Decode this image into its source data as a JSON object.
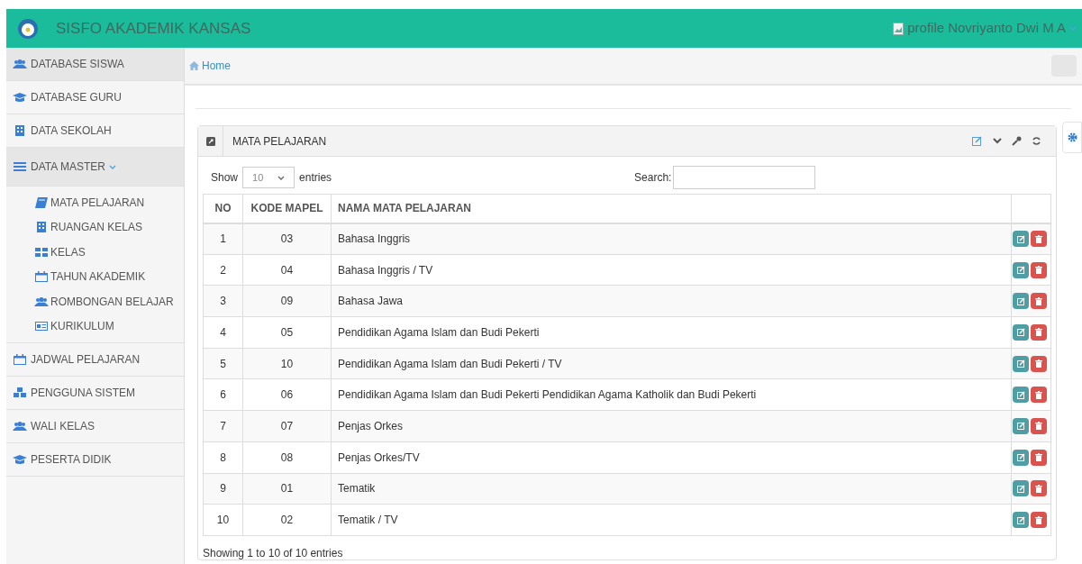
{
  "header": {
    "title": "SISFO AKADEMIK KANSAS",
    "profile_alt": "profile",
    "user_name": "Novriyanto Dwi M A"
  },
  "sidebar": {
    "items": [
      {
        "label": "DATABASE SISWA",
        "selected": true
      },
      {
        "label": "DATABASE GURU",
        "selected": false
      },
      {
        "label": "DATA SEKOLAH",
        "selected": false
      },
      {
        "label": "DATA MASTER",
        "selected": true,
        "expanded": true,
        "children": [
          {
            "label": "MATA PELAJARAN"
          },
          {
            "label": "RUANGAN KELAS"
          },
          {
            "label": "KELAS"
          },
          {
            "label": "TAHUN AKADEMIK"
          },
          {
            "label": "ROMBONGAN BELAJAR"
          },
          {
            "label": "KURIKULUM"
          }
        ]
      },
      {
        "label": "JADWAL PELAJARAN",
        "selected": false
      },
      {
        "label": "PENGGUNA SISTEM",
        "selected": false
      },
      {
        "label": "WALI KELAS",
        "selected": false
      },
      {
        "label": "PESERTA DIDIK",
        "selected": false
      }
    ]
  },
  "breadcrumb": {
    "label": "Home"
  },
  "panel": {
    "title": "MATA PELAJARAN",
    "length": {
      "before": "Show",
      "value": "10",
      "after": "entries"
    },
    "search": {
      "label": "Search:"
    },
    "table": {
      "columns": [
        "NO",
        "KODE MAPEL",
        "NAMA MATA PELAJARAN"
      ],
      "rows": [
        {
          "no": "1",
          "code": "03",
          "name": "Bahasa Inggris"
        },
        {
          "no": "2",
          "code": "04",
          "name": "Bahasa Inggris / TV"
        },
        {
          "no": "3",
          "code": "09",
          "name": "Bahasa Jawa"
        },
        {
          "no": "4",
          "code": "05",
          "name": "Pendidikan Agama Islam dan Budi Pekerti"
        },
        {
          "no": "5",
          "code": "10",
          "name": "Pendidikan Agama Islam dan Budi Pekerti / TV"
        },
        {
          "no": "6",
          "code": "06",
          "name": "Pendidikan Agama Islam dan Budi Pekerti Pendidikan Agama Katholik dan Budi Pekerti"
        },
        {
          "no": "7",
          "code": "07",
          "name": "Penjas Orkes"
        },
        {
          "no": "8",
          "code": "08",
          "name": "Penjas Orkes/TV"
        },
        {
          "no": "9",
          "code": "01",
          "name": "Tematik"
        },
        {
          "no": "10",
          "code": "02",
          "name": "Tematik / TV"
        }
      ]
    },
    "info": "Showing 1 to 10 of 10 entries"
  }
}
